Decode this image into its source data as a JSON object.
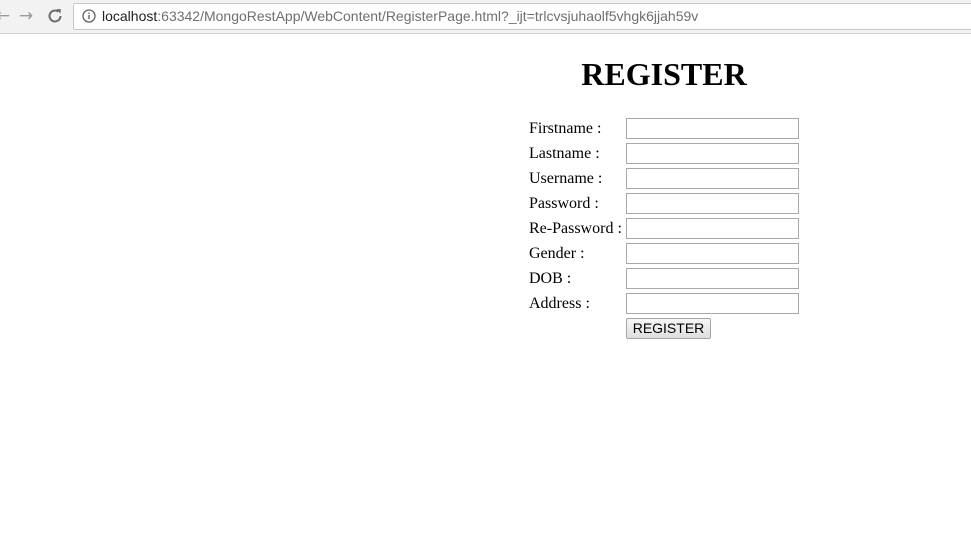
{
  "browser": {
    "url_host": "localhost",
    "url_rest": ":63342/MongoRestApp/WebContent/RegisterPage.html?_ijt=trlcvsjuhaolf5vhgk6jjah59v",
    "back_icon": "←",
    "forward_icon": "→"
  },
  "form": {
    "title": "REGISTER",
    "fields": [
      {
        "label": "Firstname :",
        "value": ""
      },
      {
        "label": "Lastname :",
        "value": ""
      },
      {
        "label": "Username :",
        "value": ""
      },
      {
        "label": "Password :",
        "value": ""
      },
      {
        "label": "Re-Password :",
        "value": ""
      },
      {
        "label": "Gender :",
        "value": ""
      },
      {
        "label": "DOB :",
        "value": ""
      },
      {
        "label": "Address :",
        "value": ""
      }
    ],
    "submit_label": "REGISTER"
  }
}
